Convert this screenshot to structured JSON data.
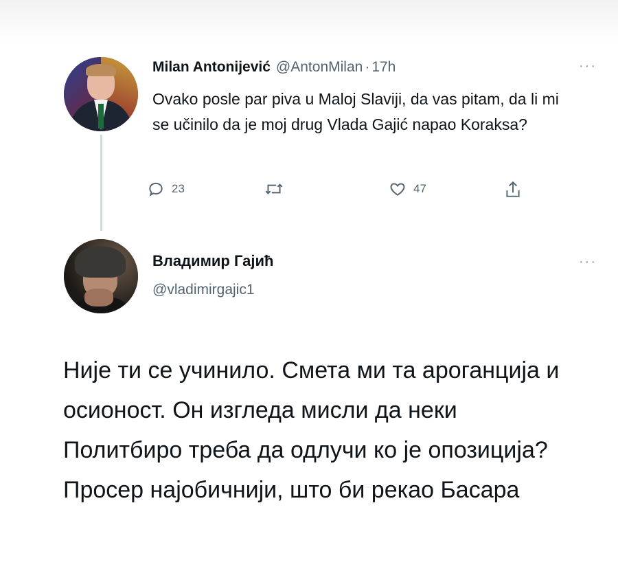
{
  "tweet1": {
    "author_name": "Milan Antonijević",
    "handle": "@AntonMilan",
    "separator": "·",
    "time": "17h",
    "more": "···",
    "text": "Ovako posle par piva u Maloj Slaviji, da vas pitam, da li mi se učinilo da je moj drug Vlada Gajić napao Koraksa?",
    "actions": {
      "reply_icon": "reply-icon",
      "reply_count": "23",
      "retweet_icon": "retweet-icon",
      "like_icon": "heart-icon",
      "like_count": "47",
      "share_icon": "share-icon"
    }
  },
  "tweet2": {
    "author_name": "Владимир Гајић",
    "handle": "@vladimirgajic1",
    "more": "···",
    "text": "Није ти се учинило. Смета ми та ароганција и осионост. Он изгледа мисли да неки Политбиро треба да одлучи ко је опозиција? Просер најобичнији, што би рекао Басара"
  },
  "colors": {
    "text_primary": "#0f1419",
    "text_secondary": "#536471",
    "thread_line": "#cfd9de",
    "background": "#ffffff"
  }
}
